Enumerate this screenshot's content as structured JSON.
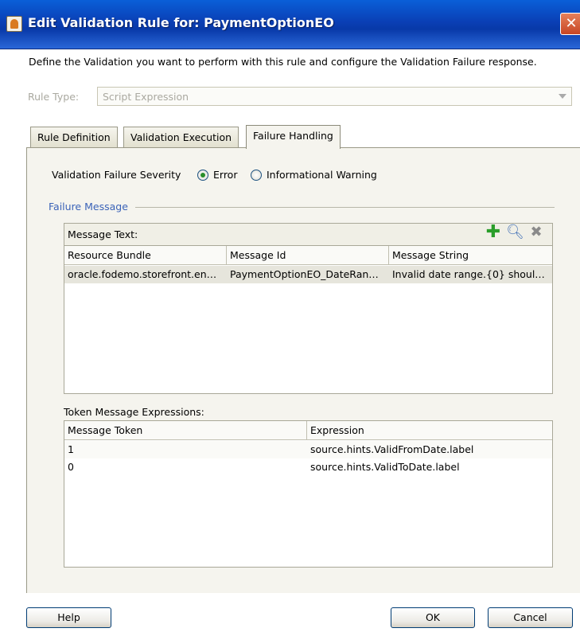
{
  "window": {
    "title": "Edit Validation Rule for: PaymentOptionEO",
    "close_glyph": "✕"
  },
  "description": "Define the Validation you want to perform with this rule and configure the Validation Failure response.",
  "rule_type": {
    "label": "Rule Type:",
    "value": "Script Expression"
  },
  "tabs": [
    {
      "label": "Rule Definition",
      "active": false
    },
    {
      "label": "Validation Execution",
      "active": false
    },
    {
      "label": "Failure Handling",
      "active": true
    }
  ],
  "severity": {
    "label": "Validation Failure Severity",
    "options": [
      {
        "label": "Error",
        "checked": true
      },
      {
        "label": "Informational Warning",
        "checked": false
      }
    ]
  },
  "failure_message": {
    "legend": "Failure Message",
    "message_text_label": "Message Text:",
    "toolbar_icons": [
      "add-icon",
      "search-icon",
      "delete-icon"
    ],
    "columns": [
      "Resource Bundle",
      "Message Id",
      "Message String"
    ],
    "rows": [
      [
        "oracle.fodemo.storefront.en…",
        "PaymentOptionEO_DateRan…",
        "Invalid date range.{0} shoul…"
      ]
    ]
  },
  "token_expressions": {
    "label": "Token Message Expressions:",
    "columns": [
      "Message Token",
      "Expression"
    ],
    "rows": [
      [
        "1",
        "source.hints.ValidFromDate.label"
      ],
      [
        "0",
        "source.hints.ValidToDate.label"
      ]
    ]
  },
  "buttons": {
    "help": "Help",
    "ok": "OK",
    "cancel": "Cancel"
  },
  "colors": {
    "titlebar": "#0a3fb5",
    "legend": "#3b63b8",
    "add_icon": "#2a9d2a"
  }
}
